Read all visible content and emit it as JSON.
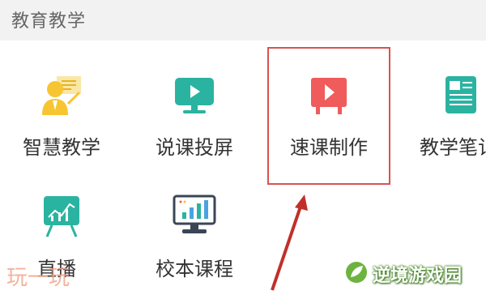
{
  "header": {
    "title": "教育教学"
  },
  "items": [
    {
      "label": "智慧教学",
      "icon": "teacher-icon"
    },
    {
      "label": "说课投屏",
      "icon": "screen-cast-icon"
    },
    {
      "label": "速课制作",
      "icon": "video-play-icon"
    },
    {
      "label": "教学笔记",
      "icon": "notes-icon"
    },
    {
      "label": "直播",
      "icon": "live-board-icon"
    },
    {
      "label": "校本课程",
      "icon": "monitor-chart-icon"
    }
  ],
  "watermarks": {
    "left": "玩一玩",
    "right": "逆境游戏园"
  },
  "colors": {
    "header_bg": "#f2f2f2",
    "teal": "#2bb3a1",
    "red": "#f05b5b",
    "yellow": "#f7c531",
    "highlight": "#d9534f"
  }
}
